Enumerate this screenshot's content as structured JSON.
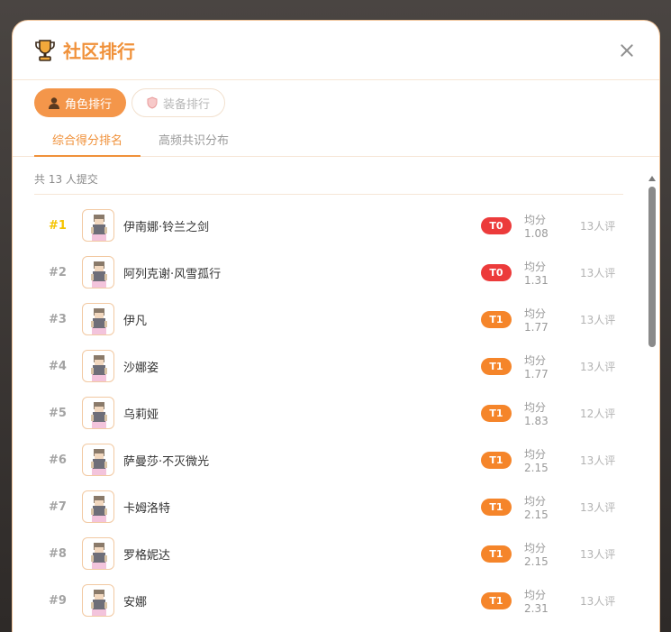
{
  "dialog": {
    "title": "社区排行",
    "icon": "trophy-icon",
    "accent_color": "#f0913a"
  },
  "pills": [
    {
      "label": "角色排行",
      "icon": "person-icon",
      "active": true
    },
    {
      "label": "装备排行",
      "icon": "shield-icon",
      "active": false
    }
  ],
  "subtabs": [
    {
      "label": "综合得分排名",
      "active": true
    },
    {
      "label": "高频共识分布",
      "active": false
    }
  ],
  "summary": "共 13 人提交",
  "tier_colors": {
    "T0": "#ec3b3b",
    "T1": "#f5852a"
  },
  "ranking": [
    {
      "rank": "#1",
      "name": "伊南娜·铃兰之剑",
      "tier": "T0",
      "avg": "均分 1.08",
      "votes": "13人评"
    },
    {
      "rank": "#2",
      "name": "阿列克谢·风雪孤行",
      "tier": "T0",
      "avg": "均分 1.31",
      "votes": "13人评"
    },
    {
      "rank": "#3",
      "name": "伊凡",
      "tier": "T1",
      "avg": "均分 1.77",
      "votes": "13人评"
    },
    {
      "rank": "#4",
      "name": "沙娜姿",
      "tier": "T1",
      "avg": "均分 1.77",
      "votes": "13人评"
    },
    {
      "rank": "#5",
      "name": "乌莉娅",
      "tier": "T1",
      "avg": "均分 1.83",
      "votes": "12人评"
    },
    {
      "rank": "#6",
      "name": "萨曼莎·不灭微光",
      "tier": "T1",
      "avg": "均分 2.15",
      "votes": "13人评"
    },
    {
      "rank": "#7",
      "name": "卡姆洛特",
      "tier": "T1",
      "avg": "均分 2.15",
      "votes": "13人评"
    },
    {
      "rank": "#8",
      "name": "罗格妮达",
      "tier": "T1",
      "avg": "均分 2.15",
      "votes": "13人评"
    },
    {
      "rank": "#9",
      "name": "安娜",
      "tier": "T1",
      "avg": "均分 2.31",
      "votes": "13人评"
    }
  ]
}
